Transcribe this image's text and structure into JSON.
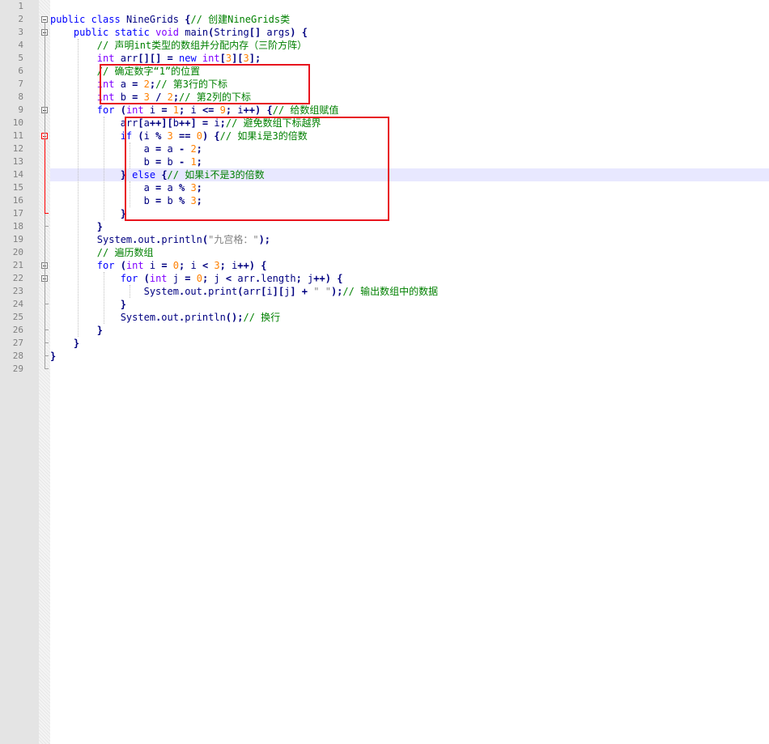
{
  "editor": {
    "lines": [
      {
        "n": "1",
        "tokens": []
      },
      {
        "n": "2",
        "tokens": [
          {
            "t": "public",
            "c": "kw"
          },
          {
            "t": " ",
            "c": ""
          },
          {
            "t": "class",
            "c": "kw"
          },
          {
            "t": " NineGrids ",
            "c": ""
          },
          {
            "t": "{",
            "c": "op"
          },
          {
            "t": "// 创建NineGrids类",
            "c": "cm"
          }
        ]
      },
      {
        "n": "3",
        "tokens": [
          {
            "t": "    ",
            "c": ""
          },
          {
            "t": "public",
            "c": "kw"
          },
          {
            "t": " ",
            "c": ""
          },
          {
            "t": "static",
            "c": "kw"
          },
          {
            "t": " ",
            "c": ""
          },
          {
            "t": "void",
            "c": "ty"
          },
          {
            "t": " main",
            "c": ""
          },
          {
            "t": "(",
            "c": "op"
          },
          {
            "t": "String",
            "c": ""
          },
          {
            "t": "[]",
            "c": "op"
          },
          {
            "t": " args",
            "c": ""
          },
          {
            "t": ")",
            "c": "op"
          },
          {
            "t": " ",
            "c": ""
          },
          {
            "t": "{",
            "c": "op"
          }
        ]
      },
      {
        "n": "4",
        "tokens": [
          {
            "t": "        ",
            "c": ""
          },
          {
            "t": "// 声明int类型的数组并分配内存（三阶方阵）",
            "c": "cm"
          }
        ]
      },
      {
        "n": "5",
        "tokens": [
          {
            "t": "        ",
            "c": ""
          },
          {
            "t": "int",
            "c": "ty"
          },
          {
            "t": " arr",
            "c": ""
          },
          {
            "t": "[][]",
            "c": "op"
          },
          {
            "t": " ",
            "c": ""
          },
          {
            "t": "=",
            "c": "op"
          },
          {
            "t": " ",
            "c": ""
          },
          {
            "t": "new",
            "c": "kw"
          },
          {
            "t": " ",
            "c": ""
          },
          {
            "t": "int",
            "c": "ty"
          },
          {
            "t": "[",
            "c": "op"
          },
          {
            "t": "3",
            "c": "num"
          },
          {
            "t": "][",
            "c": "op"
          },
          {
            "t": "3",
            "c": "num"
          },
          {
            "t": "];",
            "c": "op"
          }
        ]
      },
      {
        "n": "6",
        "tokens": [
          {
            "t": "        ",
            "c": ""
          },
          {
            "t": "// 确定数字“1”的位置",
            "c": "cm"
          }
        ]
      },
      {
        "n": "7",
        "tokens": [
          {
            "t": "        ",
            "c": ""
          },
          {
            "t": "int",
            "c": "ty"
          },
          {
            "t": " a ",
            "c": ""
          },
          {
            "t": "=",
            "c": "op"
          },
          {
            "t": " ",
            "c": ""
          },
          {
            "t": "2",
            "c": "num"
          },
          {
            "t": ";",
            "c": "op"
          },
          {
            "t": "// 第3行的下标",
            "c": "cm"
          }
        ]
      },
      {
        "n": "8",
        "tokens": [
          {
            "t": "        ",
            "c": ""
          },
          {
            "t": "int",
            "c": "ty"
          },
          {
            "t": " b ",
            "c": ""
          },
          {
            "t": "=",
            "c": "op"
          },
          {
            "t": " ",
            "c": ""
          },
          {
            "t": "3",
            "c": "num"
          },
          {
            "t": " ",
            "c": ""
          },
          {
            "t": "/",
            "c": "op"
          },
          {
            "t": " ",
            "c": ""
          },
          {
            "t": "2",
            "c": "num"
          },
          {
            "t": ";",
            "c": "op"
          },
          {
            "t": "// 第2列的下标",
            "c": "cm"
          }
        ]
      },
      {
        "n": "9",
        "tokens": [
          {
            "t": "        ",
            "c": ""
          },
          {
            "t": "for",
            "c": "kw"
          },
          {
            "t": " ",
            "c": ""
          },
          {
            "t": "(",
            "c": "op"
          },
          {
            "t": "int",
            "c": "ty"
          },
          {
            "t": " i ",
            "c": ""
          },
          {
            "t": "=",
            "c": "op"
          },
          {
            "t": " ",
            "c": ""
          },
          {
            "t": "1",
            "c": "num"
          },
          {
            "t": ";",
            "c": "op"
          },
          {
            "t": " i ",
            "c": ""
          },
          {
            "t": "<=",
            "c": "op"
          },
          {
            "t": " ",
            "c": ""
          },
          {
            "t": "9",
            "c": "num"
          },
          {
            "t": ";",
            "c": "op"
          },
          {
            "t": " i",
            "c": ""
          },
          {
            "t": "++)",
            "c": "op"
          },
          {
            "t": " ",
            "c": ""
          },
          {
            "t": "{",
            "c": "op"
          },
          {
            "t": "// 给数组赋值",
            "c": "cm"
          }
        ]
      },
      {
        "n": "10",
        "tokens": [
          {
            "t": "            ",
            "c": ""
          },
          {
            "t": "arr",
            "c": ""
          },
          {
            "t": "[",
            "c": "op"
          },
          {
            "t": "a",
            "c": ""
          },
          {
            "t": "++][",
            "c": "op"
          },
          {
            "t": "b",
            "c": ""
          },
          {
            "t": "++]",
            "c": "op"
          },
          {
            "t": " ",
            "c": ""
          },
          {
            "t": "=",
            "c": "op"
          },
          {
            "t": " i",
            "c": ""
          },
          {
            "t": ";",
            "c": "op"
          },
          {
            "t": "// 避免数组下标越界",
            "c": "cm"
          }
        ]
      },
      {
        "n": "11",
        "tokens": [
          {
            "t": "            ",
            "c": ""
          },
          {
            "t": "if",
            "c": "kw"
          },
          {
            "t": " ",
            "c": ""
          },
          {
            "t": "(",
            "c": "op"
          },
          {
            "t": "i ",
            "c": ""
          },
          {
            "t": "%",
            "c": "op"
          },
          {
            "t": " ",
            "c": ""
          },
          {
            "t": "3",
            "c": "num"
          },
          {
            "t": " ",
            "c": ""
          },
          {
            "t": "==",
            "c": "op"
          },
          {
            "t": " ",
            "c": ""
          },
          {
            "t": "0",
            "c": "num"
          },
          {
            "t": ")",
            "c": "op"
          },
          {
            "t": " ",
            "c": ""
          },
          {
            "t": "{",
            "c": "op"
          },
          {
            "t": "// 如果i是3的倍数",
            "c": "cm"
          }
        ]
      },
      {
        "n": "12",
        "tokens": [
          {
            "t": "                ",
            "c": ""
          },
          {
            "t": "a ",
            "c": ""
          },
          {
            "t": "=",
            "c": "op"
          },
          {
            "t": " a ",
            "c": ""
          },
          {
            "t": "-",
            "c": "op"
          },
          {
            "t": " ",
            "c": ""
          },
          {
            "t": "2",
            "c": "num"
          },
          {
            "t": ";",
            "c": "op"
          }
        ]
      },
      {
        "n": "13",
        "tokens": [
          {
            "t": "                ",
            "c": ""
          },
          {
            "t": "b ",
            "c": ""
          },
          {
            "t": "=",
            "c": "op"
          },
          {
            "t": " b ",
            "c": ""
          },
          {
            "t": "-",
            "c": "op"
          },
          {
            "t": " ",
            "c": ""
          },
          {
            "t": "1",
            "c": "num"
          },
          {
            "t": ";",
            "c": "op"
          }
        ]
      },
      {
        "n": "14",
        "tokens": [
          {
            "t": "            ",
            "c": ""
          },
          {
            "t": "}",
            "c": "op"
          },
          {
            "t": " ",
            "c": ""
          },
          {
            "t": "else",
            "c": "kw"
          },
          {
            "t": " ",
            "c": ""
          },
          {
            "t": "{",
            "c": "op"
          },
          {
            "t": "// 如果i不是3的倍数",
            "c": "cm"
          }
        ]
      },
      {
        "n": "15",
        "tokens": [
          {
            "t": "                ",
            "c": ""
          },
          {
            "t": "a ",
            "c": ""
          },
          {
            "t": "=",
            "c": "op"
          },
          {
            "t": " a ",
            "c": ""
          },
          {
            "t": "%",
            "c": "op"
          },
          {
            "t": " ",
            "c": ""
          },
          {
            "t": "3",
            "c": "num"
          },
          {
            "t": ";",
            "c": "op"
          }
        ]
      },
      {
        "n": "16",
        "tokens": [
          {
            "t": "                ",
            "c": ""
          },
          {
            "t": "b ",
            "c": ""
          },
          {
            "t": "=",
            "c": "op"
          },
          {
            "t": " b ",
            "c": ""
          },
          {
            "t": "%",
            "c": "op"
          },
          {
            "t": " ",
            "c": ""
          },
          {
            "t": "3",
            "c": "num"
          },
          {
            "t": ";",
            "c": "op"
          }
        ]
      },
      {
        "n": "17",
        "tokens": [
          {
            "t": "            ",
            "c": ""
          },
          {
            "t": "}",
            "c": "op"
          }
        ]
      },
      {
        "n": "18",
        "tokens": [
          {
            "t": "        ",
            "c": ""
          },
          {
            "t": "}",
            "c": "op"
          }
        ]
      },
      {
        "n": "19",
        "tokens": [
          {
            "t": "        ",
            "c": ""
          },
          {
            "t": "System",
            "c": ""
          },
          {
            "t": ".",
            "c": "op"
          },
          {
            "t": "out",
            "c": ""
          },
          {
            "t": ".",
            "c": "op"
          },
          {
            "t": "println",
            "c": ""
          },
          {
            "t": "(",
            "c": "op"
          },
          {
            "t": "\"九宫格：\"",
            "c": "str"
          },
          {
            "t": ");",
            "c": "op"
          }
        ]
      },
      {
        "n": "20",
        "tokens": [
          {
            "t": "        ",
            "c": ""
          },
          {
            "t": "// 遍历数组",
            "c": "cm"
          }
        ]
      },
      {
        "n": "21",
        "tokens": [
          {
            "t": "        ",
            "c": ""
          },
          {
            "t": "for",
            "c": "kw"
          },
          {
            "t": " ",
            "c": ""
          },
          {
            "t": "(",
            "c": "op"
          },
          {
            "t": "int",
            "c": "ty"
          },
          {
            "t": " i ",
            "c": ""
          },
          {
            "t": "=",
            "c": "op"
          },
          {
            "t": " ",
            "c": ""
          },
          {
            "t": "0",
            "c": "num"
          },
          {
            "t": ";",
            "c": "op"
          },
          {
            "t": " i ",
            "c": ""
          },
          {
            "t": "<",
            "c": "op"
          },
          {
            "t": " ",
            "c": ""
          },
          {
            "t": "3",
            "c": "num"
          },
          {
            "t": ";",
            "c": "op"
          },
          {
            "t": " i",
            "c": ""
          },
          {
            "t": "++)",
            "c": "op"
          },
          {
            "t": " ",
            "c": ""
          },
          {
            "t": "{",
            "c": "op"
          }
        ]
      },
      {
        "n": "22",
        "tokens": [
          {
            "t": "            ",
            "c": ""
          },
          {
            "t": "for",
            "c": "kw"
          },
          {
            "t": " ",
            "c": ""
          },
          {
            "t": "(",
            "c": "op"
          },
          {
            "t": "int",
            "c": "ty"
          },
          {
            "t": " j ",
            "c": ""
          },
          {
            "t": "=",
            "c": "op"
          },
          {
            "t": " ",
            "c": ""
          },
          {
            "t": "0",
            "c": "num"
          },
          {
            "t": ";",
            "c": "op"
          },
          {
            "t": " j ",
            "c": ""
          },
          {
            "t": "<",
            "c": "op"
          },
          {
            "t": " arr",
            "c": ""
          },
          {
            "t": ".",
            "c": "op"
          },
          {
            "t": "length",
            "c": ""
          },
          {
            "t": ";",
            "c": "op"
          },
          {
            "t": " j",
            "c": ""
          },
          {
            "t": "++)",
            "c": "op"
          },
          {
            "t": " ",
            "c": ""
          },
          {
            "t": "{",
            "c": "op"
          }
        ]
      },
      {
        "n": "23",
        "tokens": [
          {
            "t": "                ",
            "c": ""
          },
          {
            "t": "System",
            "c": ""
          },
          {
            "t": ".",
            "c": "op"
          },
          {
            "t": "out",
            "c": ""
          },
          {
            "t": ".",
            "c": "op"
          },
          {
            "t": "print",
            "c": ""
          },
          {
            "t": "(",
            "c": "op"
          },
          {
            "t": "arr",
            "c": ""
          },
          {
            "t": "[",
            "c": "op"
          },
          {
            "t": "i",
            "c": ""
          },
          {
            "t": "][",
            "c": "op"
          },
          {
            "t": "j",
            "c": ""
          },
          {
            "t": "]",
            "c": "op"
          },
          {
            "t": " ",
            "c": ""
          },
          {
            "t": "+",
            "c": "op"
          },
          {
            "t": " ",
            "c": ""
          },
          {
            "t": "\" \"",
            "c": "str"
          },
          {
            "t": ");",
            "c": "op"
          },
          {
            "t": "// 输出数组中的数据",
            "c": "cm"
          }
        ]
      },
      {
        "n": "24",
        "tokens": [
          {
            "t": "            ",
            "c": ""
          },
          {
            "t": "}",
            "c": "op"
          }
        ]
      },
      {
        "n": "25",
        "tokens": [
          {
            "t": "            ",
            "c": ""
          },
          {
            "t": "System",
            "c": ""
          },
          {
            "t": ".",
            "c": "op"
          },
          {
            "t": "out",
            "c": ""
          },
          {
            "t": ".",
            "c": "op"
          },
          {
            "t": "println",
            "c": ""
          },
          {
            "t": "();",
            "c": "op"
          },
          {
            "t": "// 换行",
            "c": "cm"
          }
        ]
      },
      {
        "n": "26",
        "tokens": [
          {
            "t": "        ",
            "c": ""
          },
          {
            "t": "}",
            "c": "op"
          }
        ]
      },
      {
        "n": "27",
        "tokens": [
          {
            "t": "    ",
            "c": ""
          },
          {
            "t": "}",
            "c": "op"
          }
        ]
      },
      {
        "n": "28",
        "tokens": [
          {
            "t": "}",
            "c": "op"
          }
        ]
      },
      {
        "n": "29",
        "tokens": []
      }
    ],
    "current_line": "14",
    "colors": {
      "keyword": "#0000ff",
      "type": "#8000ff",
      "number": "#ff8000",
      "operator": "#000080",
      "comment": "#008000",
      "string": "#808080",
      "current_line_bg": "#e8e8ff",
      "annotation_box": "#e8141e"
    }
  }
}
